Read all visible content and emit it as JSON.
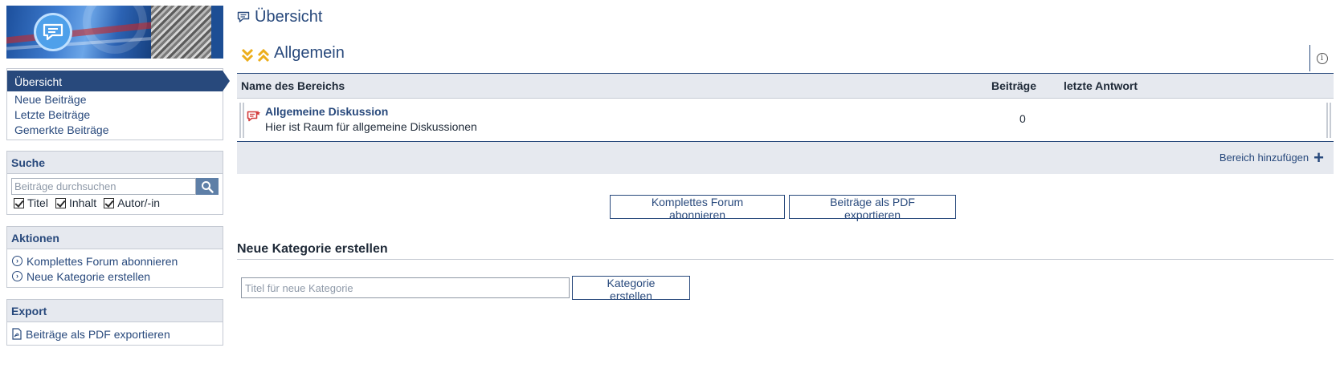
{
  "colors": {
    "primary": "#28497c",
    "header_bg": "#e6e9ef",
    "accent_chevron": "#ecae1c",
    "forum_icon": "#d23c3c"
  },
  "sidebar": {
    "nav": [
      {
        "label": "Übersicht",
        "active": true
      },
      {
        "label": "Neue Beiträge"
      },
      {
        "label": "Letzte Beiträge"
      },
      {
        "label": "Gemerkte Beiträge"
      }
    ],
    "search": {
      "heading": "Suche",
      "placeholder": "Beiträge durchsuchen",
      "options": [
        "Titel",
        "Inhalt",
        "Autor/-in"
      ]
    },
    "actions": {
      "heading": "Aktionen",
      "items": [
        "Komplettes Forum abonnieren",
        "Neue Kategorie erstellen"
      ]
    },
    "export": {
      "heading": "Export",
      "items": [
        "Beiträge als PDF exportieren"
      ]
    }
  },
  "main": {
    "title": "Übersicht",
    "category": {
      "name": "Allgemein",
      "columns": [
        "Name des Bereichs",
        "Beiträge",
        "letzte Antwort"
      ],
      "rows": [
        {
          "title": "Allgemeine Diskussion",
          "description": "Hier ist Raum für allgemeine Diskussionen",
          "posts": "0",
          "last_reply": ""
        }
      ],
      "add_area_label": "Bereich hinzufügen"
    },
    "buttons": {
      "subscribe": "Komplettes Forum abonnieren",
      "export_pdf": "Beiträge als PDF exportieren"
    },
    "new_category": {
      "heading": "Neue Kategorie erstellen",
      "placeholder": "Titel für neue Kategorie",
      "button": "Kategorie erstellen"
    }
  }
}
